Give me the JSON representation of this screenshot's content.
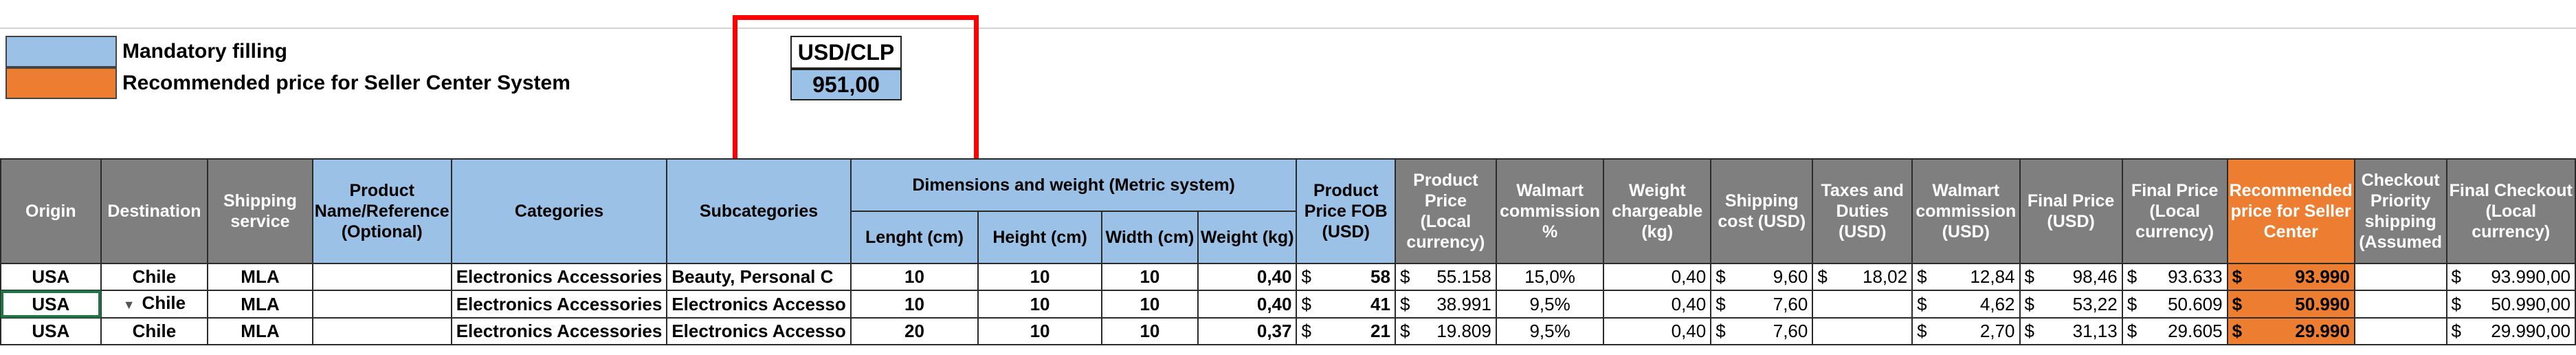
{
  "legend": {
    "mandatory": "Mandatory filling",
    "recommended": "Recommended price for Seller Center System",
    "mandatory_color": "#9bc2e6",
    "recommended_color": "#ed7d31"
  },
  "fx": {
    "label": "USD/CLP",
    "value": "951,00"
  },
  "headers": {
    "origin": "Origin",
    "destination": "Destination",
    "shipping_service": "Shipping service",
    "product_name": "Product Name/Reference (Optional)",
    "categories": "Categories",
    "subcategories": "Subcategories",
    "dimensions_group": "Dimensions and weight (Metric system)",
    "length": "Lenght (cm)",
    "height": "Height (cm)",
    "width": "Width (cm)",
    "weight": "Weight (kg)",
    "product_price_fob": "Product Price FOB (USD)",
    "product_price_local": "Product Price (Local currency)",
    "walmart_commission_pct": "Walmart commission %",
    "weight_chargeable": "Weight chargeable (kg)",
    "shipping_cost": "Shipping cost (USD)",
    "taxes_duties": "Taxes and Duties (USD)",
    "walmart_commission_usd": "Walmart commission (USD)",
    "final_price_usd": "Final Price (USD)",
    "final_price_local": "Final Price (Local currency)",
    "recommended_price": "Recommended price for Seller Center",
    "checkout_priority": "Checkout Priority shipping (Assumed",
    "final_checkout": "Final Checkout (Local currency)"
  },
  "rows": [
    {
      "origin": "USA",
      "destination": "Chile",
      "service": "MLA",
      "product": "",
      "category": "Electronics Accessories",
      "subcategory": "Beauty, Personal C",
      "length": "10",
      "height": "10",
      "width": "10",
      "weight": "0,40",
      "fob": "58",
      "price_local": "55.158",
      "commission_pct": "15,0%",
      "chargeable": "0,40",
      "shipping": "9,60",
      "taxes": "18,02",
      "commission_usd": "12,84",
      "final_usd": "98,46",
      "final_local": "93.633",
      "recommended": "93.990",
      "checkout_priority": "",
      "final_checkout": "93.990,00"
    },
    {
      "origin": "USA",
      "destination": "Chile",
      "service": "MLA",
      "product": "",
      "category": "Electronics Accessories",
      "subcategory": "Electronics Accesso",
      "length": "10",
      "height": "10",
      "width": "10",
      "weight": "0,40",
      "fob": "41",
      "price_local": "38.991",
      "commission_pct": "9,5%",
      "chargeable": "0,40",
      "shipping": "7,60",
      "taxes": "",
      "commission_usd": "4,62",
      "final_usd": "53,22",
      "final_local": "50.609",
      "recommended": "50.990",
      "checkout_priority": "",
      "final_checkout": "50.990,00"
    },
    {
      "origin": "USA",
      "destination": "Chile",
      "service": "MLA",
      "product": "",
      "category": "Electronics Accessories",
      "subcategory": "Electronics Accesso",
      "length": "20",
      "height": "10",
      "width": "10",
      "weight": "0,37",
      "fob": "21",
      "price_local": "19.809",
      "commission_pct": "9,5%",
      "chargeable": "0,40",
      "shipping": "7,60",
      "taxes": "",
      "commission_usd": "2,70",
      "final_usd": "31,13",
      "final_local": "29.605",
      "recommended": "29.990",
      "checkout_priority": "",
      "final_checkout": "29.990,00"
    }
  ],
  "currency_symbol": "$"
}
